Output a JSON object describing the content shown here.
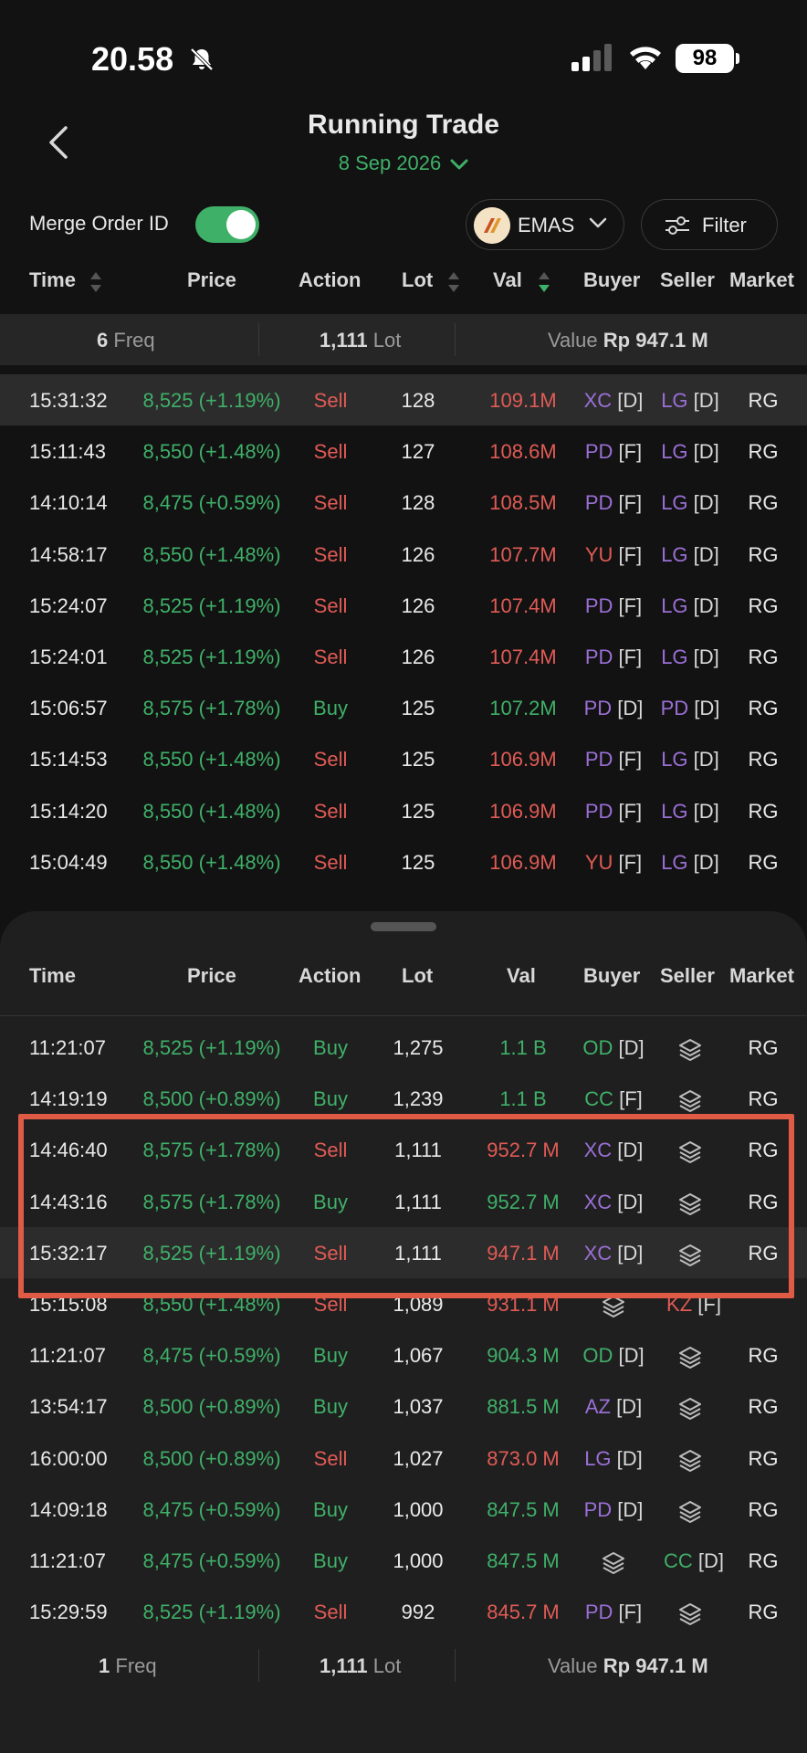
{
  "status": {
    "time": "20.58",
    "battery": "98"
  },
  "header": {
    "title": "Running Trade",
    "date": "8 Sep 2026"
  },
  "controls": {
    "merge_label": "Merge Order ID",
    "merge_on": true,
    "stock": "EMAS",
    "filter_label": "Filter"
  },
  "columns": {
    "time": "Time",
    "price": "Price",
    "action": "Action",
    "lot": "Lot",
    "val": "Val",
    "buyer": "Buyer",
    "seller": "Seller",
    "market": "Market"
  },
  "summary_top": {
    "freq_num": "6",
    "freq_label": "Freq",
    "lot_num": "1,111",
    "lot_label": "Lot",
    "value_label": "Value",
    "value_num": "Rp 947.1 M"
  },
  "trades": [
    {
      "time": "15:31:32",
      "price": "8,525 (+1.19%)",
      "action": "Sell",
      "lot": "128",
      "val": "109.1M",
      "buyer": "XC",
      "buyer_tag": "[D]",
      "buyer_color": "#9b6fd6",
      "seller": "LG",
      "seller_tag": "[D]",
      "seller_color": "#9b6fd6",
      "market": "RG"
    },
    {
      "time": "15:11:43",
      "price": "8,550 (+1.48%)",
      "action": "Sell",
      "lot": "127",
      "val": "108.6M",
      "buyer": "PD",
      "buyer_tag": "[F]",
      "buyer_color": "#9b6fd6",
      "seller": "LG",
      "seller_tag": "[D]",
      "seller_color": "#9b6fd6",
      "market": "RG"
    },
    {
      "time": "14:10:14",
      "price": "8,475 (+0.59%)",
      "action": "Sell",
      "lot": "128",
      "val": "108.5M",
      "buyer": "PD",
      "buyer_tag": "[F]",
      "buyer_color": "#9b6fd6",
      "seller": "LG",
      "seller_tag": "[D]",
      "seller_color": "#9b6fd6",
      "market": "RG"
    },
    {
      "time": "14:58:17",
      "price": "8,550 (+1.48%)",
      "action": "Sell",
      "lot": "126",
      "val": "107.7M",
      "buyer": "YU",
      "buyer_tag": "[F]",
      "buyer_color": "#e05b55",
      "seller": "LG",
      "seller_tag": "[D]",
      "seller_color": "#9b6fd6",
      "market": "RG"
    },
    {
      "time": "15:24:07",
      "price": "8,525 (+1.19%)",
      "action": "Sell",
      "lot": "126",
      "val": "107.4M",
      "buyer": "PD",
      "buyer_tag": "[F]",
      "buyer_color": "#9b6fd6",
      "seller": "LG",
      "seller_tag": "[D]",
      "seller_color": "#9b6fd6",
      "market": "RG"
    },
    {
      "time": "15:24:01",
      "price": "8,525 (+1.19%)",
      "action": "Sell",
      "lot": "126",
      "val": "107.4M",
      "buyer": "PD",
      "buyer_tag": "[F]",
      "buyer_color": "#9b6fd6",
      "seller": "LG",
      "seller_tag": "[D]",
      "seller_color": "#9b6fd6",
      "market": "RG"
    },
    {
      "time": "15:06:57",
      "price": "8,575 (+1.78%)",
      "action": "Buy",
      "lot": "125",
      "val": "107.2M",
      "buyer": "PD",
      "buyer_tag": "[D]",
      "buyer_color": "#9b6fd6",
      "seller": "PD",
      "seller_tag": "[D]",
      "seller_color": "#9b6fd6",
      "market": "RG"
    },
    {
      "time": "15:14:53",
      "price": "8,550 (+1.48%)",
      "action": "Sell",
      "lot": "125",
      "val": "106.9M",
      "buyer": "PD",
      "buyer_tag": "[F]",
      "buyer_color": "#9b6fd6",
      "seller": "LG",
      "seller_tag": "[D]",
      "seller_color": "#9b6fd6",
      "market": "RG"
    },
    {
      "time": "15:14:20",
      "price": "8,550 (+1.48%)",
      "action": "Sell",
      "lot": "125",
      "val": "106.9M",
      "buyer": "PD",
      "buyer_tag": "[F]",
      "buyer_color": "#9b6fd6",
      "seller": "LG",
      "seller_tag": "[D]",
      "seller_color": "#9b6fd6",
      "market": "RG"
    },
    {
      "time": "15:04:49",
      "price": "8,550 (+1.48%)",
      "action": "Sell",
      "lot": "125",
      "val": "106.9M",
      "buyer": "YU",
      "buyer_tag": "[F]",
      "buyer_color": "#e05b55",
      "seller": "LG",
      "seller_tag": "[D]",
      "seller_color": "#9b6fd6",
      "market": "RG"
    }
  ],
  "sheet_trades": [
    {
      "time": "11:21:07",
      "price": "8,525 (+1.19%)",
      "action": "Buy",
      "lot": "1,275",
      "val": "1.1 B",
      "buyer": "OD",
      "buyer_tag": "[D]",
      "buyer_color": "#3fb068",
      "market": "RG"
    },
    {
      "time": "14:19:19",
      "price": "8,500 (+0.89%)",
      "action": "Buy",
      "lot": "1,239",
      "val": "1.1 B",
      "buyer": "CC",
      "buyer_tag": "[F]",
      "buyer_color": "#3fb068",
      "market": "RG"
    },
    {
      "time": "14:46:40",
      "price": "8,575 (+1.78%)",
      "action": "Sell",
      "lot": "1,111",
      "val": "952.7 M",
      "buyer": "XC",
      "buyer_tag": "[D]",
      "buyer_color": "#9b6fd6",
      "market": "RG"
    },
    {
      "time": "14:43:16",
      "price": "8,575 (+1.78%)",
      "action": "Buy",
      "lot": "1,111",
      "val": "952.7 M",
      "buyer": "XC",
      "buyer_tag": "[D]",
      "buyer_color": "#9b6fd6",
      "market": "RG"
    },
    {
      "time": "15:32:17",
      "price": "8,525 (+1.19%)",
      "action": "Sell",
      "lot": "1,111",
      "val": "947.1 M",
      "buyer": "XC",
      "buyer_tag": "[D]",
      "buyer_color": "#9b6fd6",
      "market": "RG",
      "highlight": true
    },
    {
      "time": "15:15:08",
      "price": "8,550 (+1.48%)",
      "action": "Sell",
      "lot": "1,089",
      "val": "931.1 M",
      "seller": "KZ",
      "seller_tag": "[F]",
      "seller_color": "#e05b55",
      "market": ""
    },
    {
      "time": "11:21:07",
      "price": "8,475 (+0.59%)",
      "action": "Buy",
      "lot": "1,067",
      "val": "904.3 M",
      "buyer": "OD",
      "buyer_tag": "[D]",
      "buyer_color": "#3fb068",
      "market": "RG"
    },
    {
      "time": "13:54:17",
      "price": "8,500 (+0.89%)",
      "action": "Buy",
      "lot": "1,037",
      "val": "881.5 M",
      "buyer": "AZ",
      "buyer_tag": "[D]",
      "buyer_color": "#9b6fd6",
      "market": "RG"
    },
    {
      "time": "16:00:00",
      "price": "8,500 (+0.89%)",
      "action": "Sell",
      "lot": "1,027",
      "val": "873.0 M",
      "buyer": "LG",
      "buyer_tag": "[D]",
      "buyer_color": "#9b6fd6",
      "market": "RG"
    },
    {
      "time": "14:09:18",
      "price": "8,475 (+0.59%)",
      "action": "Buy",
      "lot": "1,000",
      "val": "847.5 M",
      "buyer": "PD",
      "buyer_tag": "[D]",
      "buyer_color": "#9b6fd6",
      "market": "RG"
    },
    {
      "time": "11:21:07",
      "price": "8,475 (+0.59%)",
      "action": "Buy",
      "lot": "1,000",
      "val": "847.5 M",
      "seller": "CC",
      "seller_tag": "[D]",
      "seller_color": "#3fb068",
      "market": "RG"
    },
    {
      "time": "15:29:59",
      "price": "8,525 (+1.19%)",
      "action": "Sell",
      "lot": "992",
      "val": "845.7 M",
      "buyer": "PD",
      "buyer_tag": "[F]",
      "buyer_color": "#9b6fd6",
      "market": "RG"
    }
  ],
  "summary_bottom": {
    "freq_num": "1",
    "freq_label": "Freq",
    "lot_num": "1,111",
    "lot_label": "Lot",
    "value_label": "Value",
    "value_num": "Rp 947.1 M"
  },
  "colors": {
    "buy": "#3fb068",
    "sell": "#e05b55",
    "accent": "#3fb068",
    "highlight_box": "#e05b45"
  }
}
